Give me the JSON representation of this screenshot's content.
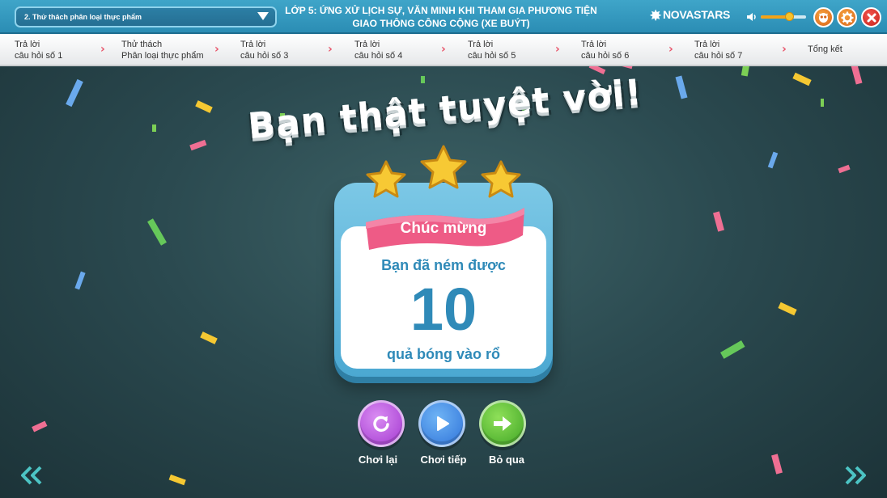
{
  "header": {
    "lesson_select": "2. Thử thách phân loại thực phẩm",
    "title_line1": "LỚP 5:  ỨNG XỬ LỊCH SỰ, VĂN MINH KHI THAM GIA PHƯƠNG TIỆN",
    "title_line2": "GIAO THÔNG CÔNG CỘNG (XE BUÝT)",
    "logo": "NOVASTARS",
    "volume_level": 0.62,
    "colors": {
      "header_bg": "#2b8db4",
      "accent": "#f2a318",
      "close": "#c8241c"
    }
  },
  "steps": [
    {
      "line1": "Trả lời",
      "line2": "câu hỏi số 1"
    },
    {
      "line1": "Thử thách",
      "line2": "Phân loại thực phẩm"
    },
    {
      "line1": "Trả lời",
      "line2": "câu hỏi số 3"
    },
    {
      "line1": "Trả lời",
      "line2": "câu hỏi số 4"
    },
    {
      "line1": "Trả lời",
      "line2": "câu hỏi số 5"
    },
    {
      "line1": "Trả lời",
      "line2": "câu hỏi số 6"
    },
    {
      "line1": "Trả lời",
      "line2": "câu hỏi số 7"
    },
    {
      "line1": "Tổng kết",
      "line2": ""
    }
  ],
  "result": {
    "headline": "Bạn thật tuyệt vời!",
    "ribbon": "Chúc mừng",
    "line1": "Bạn đã ném được",
    "count": "10",
    "line2": "quả bóng vào rổ",
    "stars_earned": 3,
    "stars_total": 3
  },
  "actions": {
    "replay": "Chơi lại",
    "continue": "Chơi tiếp",
    "skip": "Bỏ qua"
  },
  "icons": {
    "volume": "speaker-icon",
    "owl": "owl-icon",
    "settings": "gear-icon",
    "close": "close-icon",
    "replay": "replay-icon",
    "play": "play-icon",
    "skip": "arrow-right-icon",
    "prev": "double-chevron-left-icon",
    "next": "double-chevron-right-icon"
  }
}
